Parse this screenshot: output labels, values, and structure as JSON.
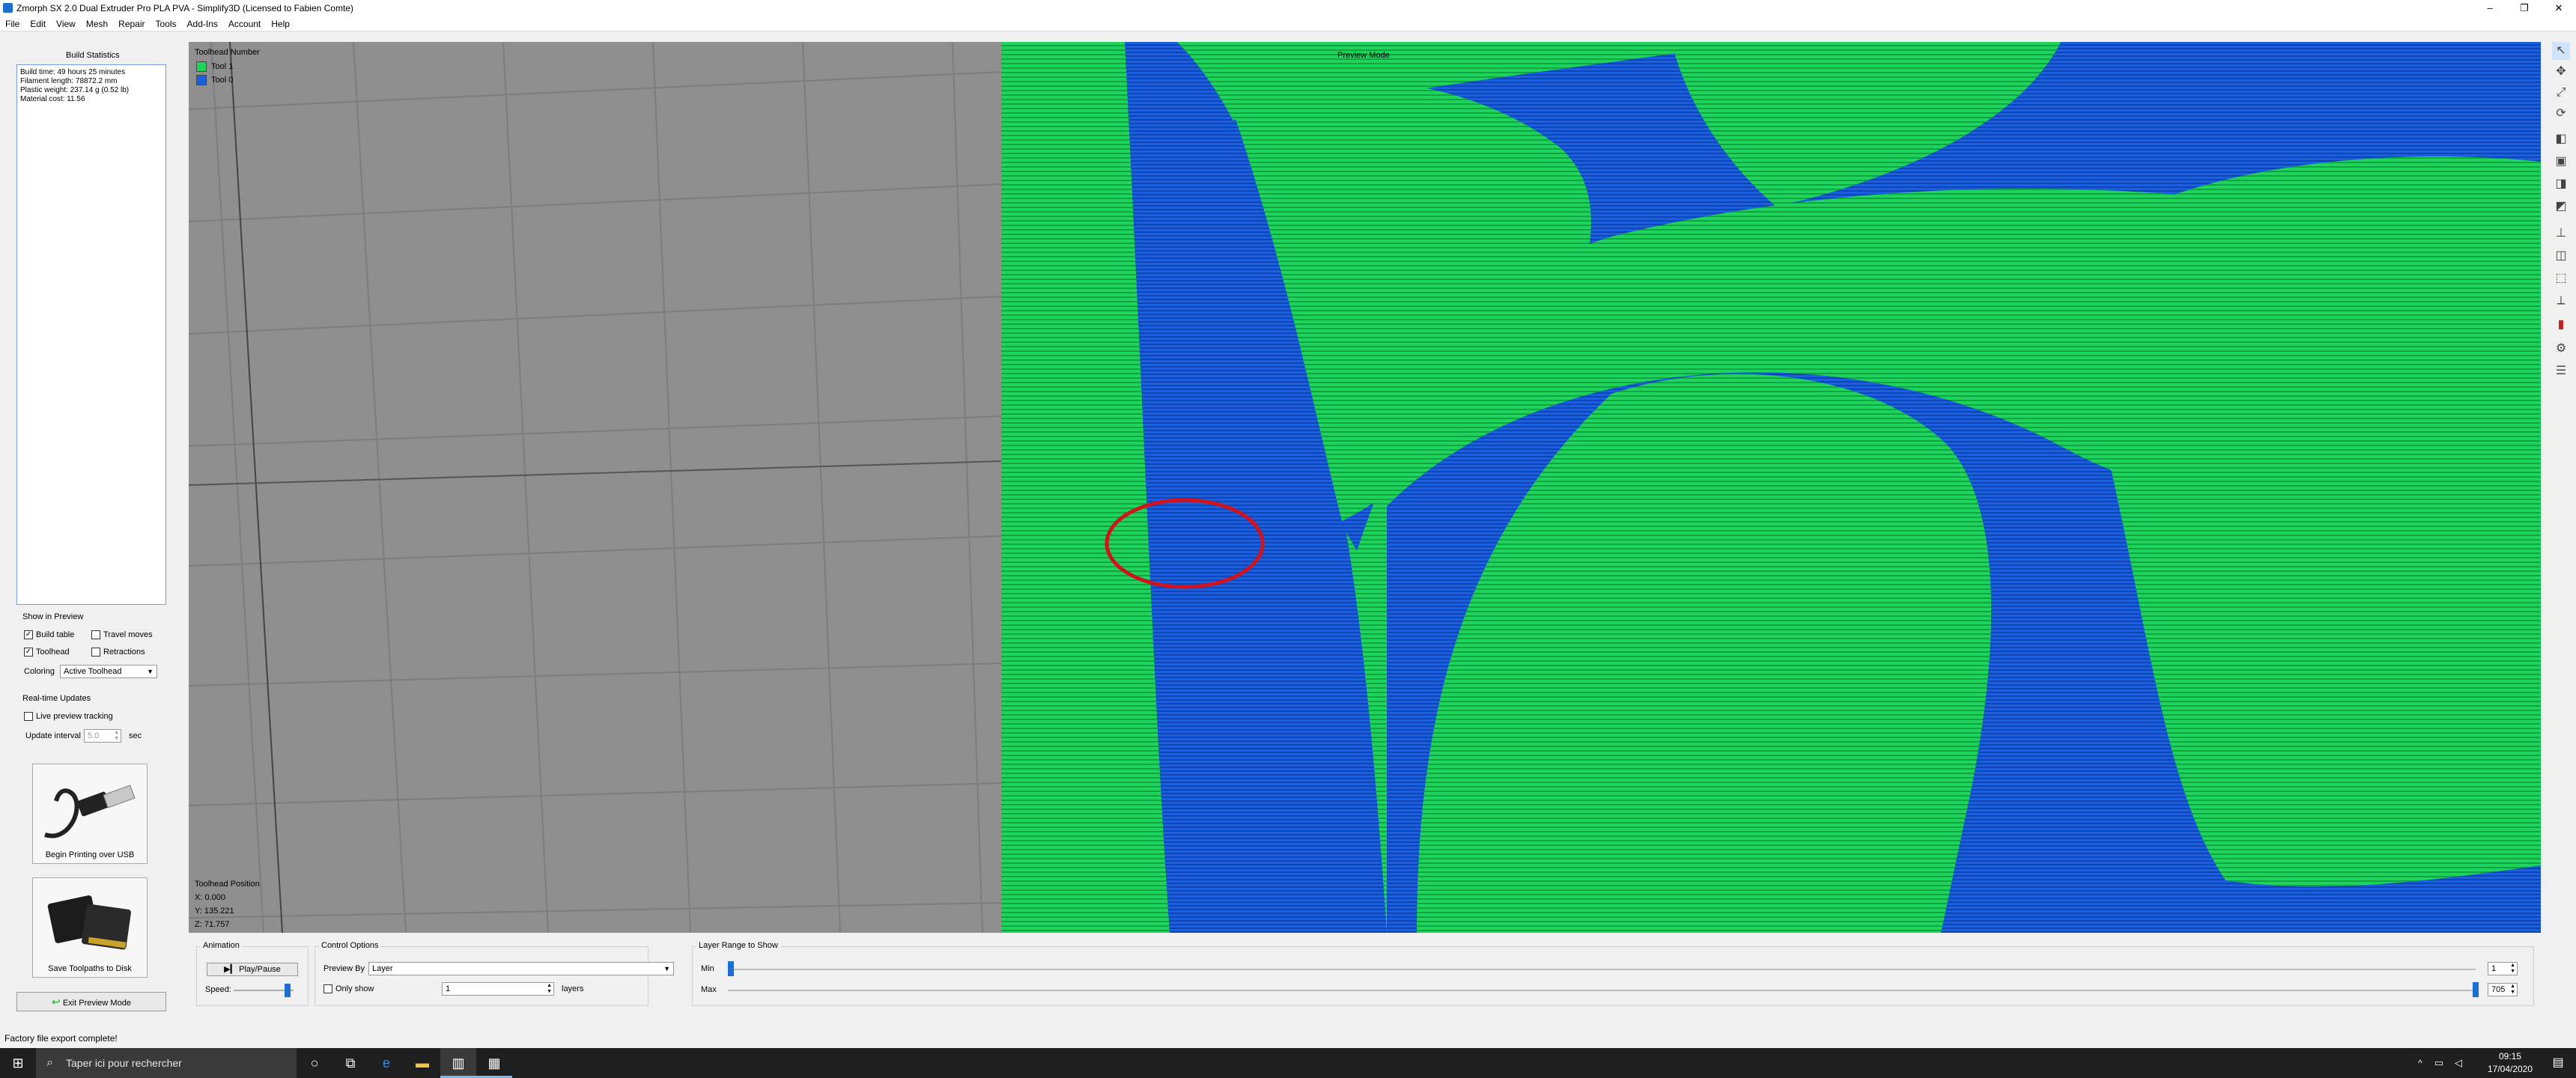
{
  "window": {
    "title": "Zmorph SX 2.0 Dual Extruder Pro PLA PVA - Simplify3D (Licensed to Fabien Comte)",
    "controls": [
      "–",
      "❐",
      "✕"
    ]
  },
  "menu": [
    "File",
    "Edit",
    "View",
    "Mesh",
    "Repair",
    "Tools",
    "Add-Ins",
    "Account",
    "Help"
  ],
  "left": {
    "build_statistics_title": "Build Statistics",
    "stats": [
      "Build time: 49 hours 25 minutes",
      "Filament length: 78872.2 mm",
      "Plastic weight: 237.14 g (0.52 lb)",
      "Material cost: 11.56"
    ],
    "show_in_preview": {
      "title": "Show in Preview",
      "build_table": "Build table",
      "travel_moves": "Travel moves",
      "toolhead": "Toolhead",
      "retractions": "Retractions",
      "coloring_label": "Coloring",
      "coloring_value": "Active Toolhead"
    },
    "realtime": {
      "title": "Real-time Updates",
      "live_tracking": "Live preview tracking",
      "update_interval_label": "Update interval",
      "update_interval_value": "5.0",
      "update_interval_unit": "sec"
    },
    "usb_button": "Begin Printing over USB",
    "sd_button": "Save Toolpaths to Disk",
    "exit_button": "Exit Preview Mode"
  },
  "viewport": {
    "legend_title": "Toolhead Number",
    "legend": [
      {
        "label": "Tool 1",
        "color": "#1fd45a"
      },
      {
        "label": "Tool 0",
        "color": "#1a5fe0"
      }
    ],
    "preview_mode_label": "Preview Mode",
    "toolhead_position": {
      "title": "Toolhead Position",
      "x": "X: 0.000",
      "y": "Y: 135.221",
      "z": "Z: 71.757"
    },
    "colors": {
      "tool1": "#1fd45a",
      "tool0": "#1a5fe0",
      "background": "#8f8f8f",
      "highlight": "#d0141d"
    }
  },
  "bottom": {
    "animation_title": "Animation",
    "play_pause": "Play/Pause",
    "speed_label": "Speed:",
    "control_options_title": "Control Options",
    "preview_by_label": "Preview By",
    "preview_by_value": "Layer",
    "only_show_label": "Only show",
    "only_show_value": "1",
    "layers_label": "layers",
    "layer_range_title": "Layer Range to Show",
    "min_label": "Min",
    "max_label": "Max",
    "min_value": "1",
    "max_value": "705"
  },
  "statusbar": {
    "text": "Factory file export complete!"
  },
  "taskbar": {
    "search_placeholder": "Taper ici pour rechercher",
    "time": "09:15",
    "date": "17/04/2020"
  }
}
